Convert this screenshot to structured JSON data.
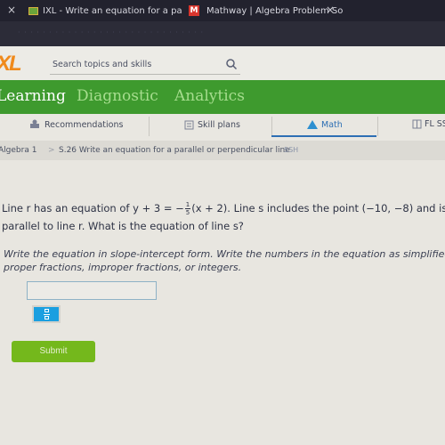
{
  "browser": {
    "tabs": [
      {
        "label": "IXL - Write an equation for a pa",
        "active": true
      },
      {
        "label": "Mathway | Algebra Problem So",
        "active": false
      }
    ],
    "close_glyph": "×",
    "address_text": "· · · · · · · · · · · · · · · · · · · · · · · · · · · · · ·"
  },
  "header": {
    "logo": "XL",
    "search_placeholder": "Search topics and skills"
  },
  "nav": {
    "items": [
      {
        "label": "Learning",
        "active": true
      },
      {
        "label": "Diagnostic",
        "active": false
      },
      {
        "label": "Analytics",
        "active": false
      }
    ]
  },
  "subnav": {
    "items": [
      {
        "label": "Recommendations",
        "icon": "recommendations-icon"
      },
      {
        "label": "Skill plans",
        "icon": "skill-plans-icon"
      },
      {
        "label": "Math",
        "icon": "math-icon",
        "active": true
      },
      {
        "label": "FL SS",
        "icon": "standards-icon"
      }
    ]
  },
  "breadcrumb": {
    "level": "Algebra 1",
    "separator": ">",
    "skill": "S.26 Write an equation for a parallel or perpendicular line",
    "code": "5SH"
  },
  "question": {
    "line1_pre": "Line r has an equation of y + 3 = −",
    "fraction_num": "1",
    "fraction_den": "5",
    "line1_post": "(x + 2). Line s includes the point (−10, −8) and is",
    "line2": "parallel to line r. What is the equation of line s?",
    "instruction_line1": "Write the equation in slope-intercept form. Write the numbers in the equation as simplified",
    "instruction_line2": "proper fractions, improper fractions, or integers.",
    "answer_value": ""
  },
  "submit_label": "Submit",
  "colors": {
    "nav_green": "#3e9a2e",
    "logo_orange": "#f08a1c",
    "submit_green": "#74b81c",
    "fraction_button_blue": "#1b9fe0",
    "active_underline": "#2d6fb4"
  }
}
